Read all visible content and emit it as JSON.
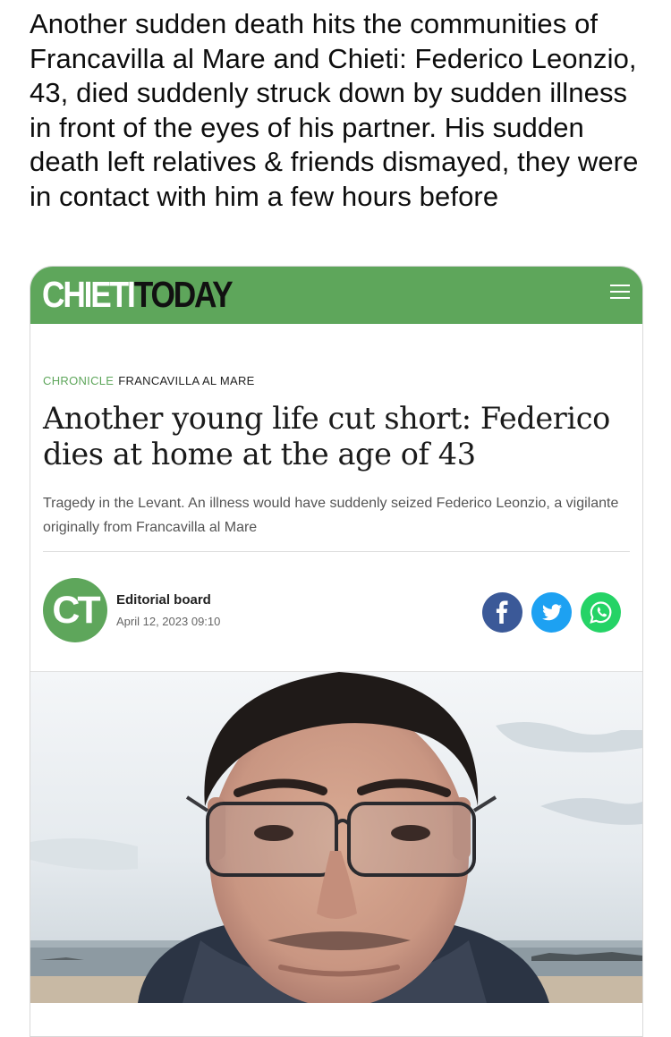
{
  "post": {
    "text": "Another sudden death hits the communities of Francavilla al Mare and Chieti: Federico Leonzio, 43, died suddenly struck down by sudden illness in front of the eyes of his partner. His sudden death left relatives & friends dismayed, they were in contact with him a few hours before"
  },
  "site": {
    "brand_part1": "CHIETI",
    "brand_part2": "TODAY",
    "accent_color": "#5ea65b"
  },
  "article": {
    "section": "CHRONICLE",
    "location": "FRANCAVILLA AL MARE",
    "headline": "Another young life cut short: Federico dies at home at the age of 43",
    "standfirst": "Tragedy in the Levant. An illness would have suddenly seized Federico Leonzio, a vigilante originally from Francavilla al Mare",
    "author_initials": "CT",
    "author": "Editorial board",
    "date": "April 12, 2023 09:10"
  },
  "share": {
    "icons": [
      "facebook-icon",
      "twitter-icon",
      "whatsapp-icon"
    ],
    "colors": {
      "facebook": "#3b5998",
      "twitter": "#1da1f2",
      "whatsapp": "#25d366"
    }
  },
  "icons": {
    "menu": "hamburger-menu-icon"
  }
}
